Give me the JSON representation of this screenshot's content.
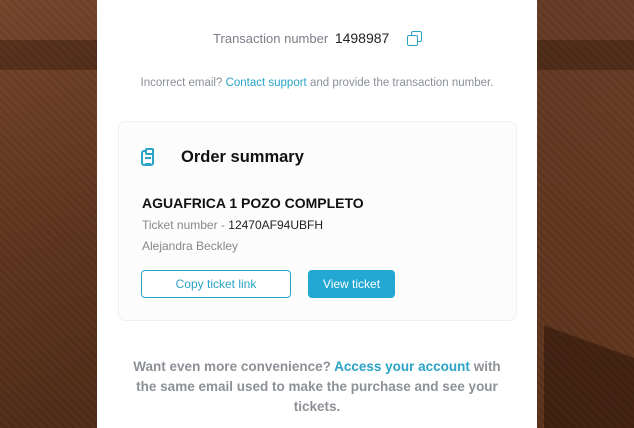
{
  "transaction": {
    "label": "Transaction number",
    "number": "1498987",
    "copy_icon": "copy-icon"
  },
  "note": {
    "prefix": "Incorrect email?",
    "link": "Contact support",
    "suffix": "and provide the transaction number."
  },
  "order_summary": {
    "icon": "clipboard-icon",
    "title": "Order summary",
    "event_name": "AGUAFRICA 1 POZO COMPLETO",
    "ticket_label": "Ticket number -",
    "ticket_number": "12470AF94UBFH",
    "holder_name": "Alejandra Beckley",
    "copy_link_button": "Copy ticket link",
    "view_ticket_button": "View ticket"
  },
  "promo": {
    "prefix": "Want even more convenience?",
    "link": "Access your account",
    "suffix": "with the same email used to make the purchase and see your tickets."
  },
  "colors": {
    "accent": "#2aa3c7",
    "button_fill": "#22a8d2",
    "background": "#6b3d22"
  }
}
